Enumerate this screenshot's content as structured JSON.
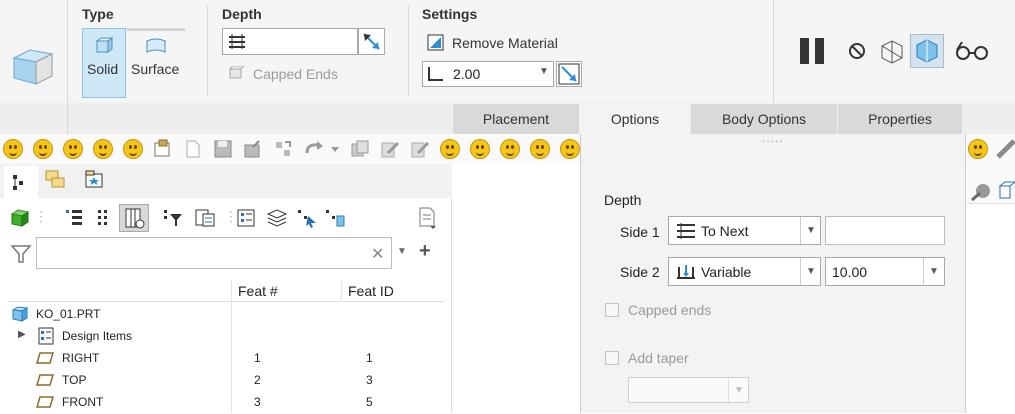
{
  "ribbon": {
    "type_group": {
      "label": "Type",
      "solid": "Solid",
      "surface": "Surface"
    },
    "depth_group": {
      "label": "Depth",
      "capped_ends": "Capped Ends"
    },
    "settings_group": {
      "label": "Settings",
      "remove_material": "Remove Material",
      "thickness_value": "2.00"
    }
  },
  "tabs": [
    {
      "label": "Placement"
    },
    {
      "label": "Options"
    },
    {
      "label": "Body Options"
    },
    {
      "label": "Properties"
    }
  ],
  "options_panel": {
    "depth_label": "Depth",
    "side1_label": "Side 1",
    "side1_value": "To Next",
    "side1_input": "",
    "side2_label": "Side 2",
    "side2_value": "Variable",
    "side2_depth": "10.00",
    "capped_ends": "Capped ends",
    "add_taper": "Add taper",
    "handle": "....."
  },
  "model_tree": {
    "search_placeholder": "",
    "col_feat_num": "Feat #",
    "col_feat_id": "Feat ID",
    "rows": [
      {
        "name": "KO_01.PRT",
        "feat_num": "",
        "feat_id": ""
      },
      {
        "name": "Design Items",
        "feat_num": "",
        "feat_id": ""
      },
      {
        "name": "RIGHT",
        "feat_num": "1",
        "feat_id": "1"
      },
      {
        "name": "TOP",
        "feat_num": "2",
        "feat_id": "3"
      },
      {
        "name": "FRONT",
        "feat_num": "3",
        "feat_id": "5"
      }
    ]
  },
  "colors": {
    "accent_blue": "#2a8fd8",
    "selected_bg": "#cfe8f7",
    "tab_bg": "#d9d9d9"
  }
}
